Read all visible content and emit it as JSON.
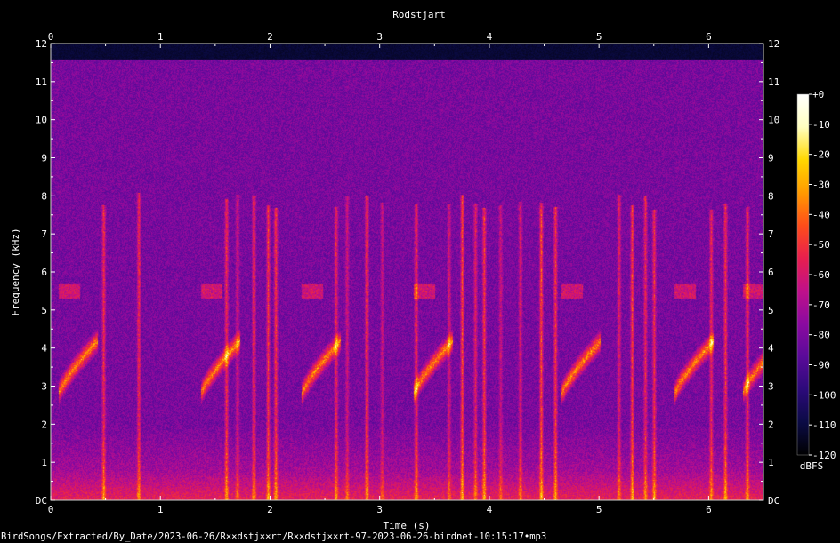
{
  "chart_data": {
    "type": "heatmap",
    "title": "Rodstjart",
    "xlabel": "Time (s)",
    "ylabel": "Frequency (kHz)",
    "xlim": [
      0,
      6.5
    ],
    "ylim": [
      0,
      12
    ],
    "x_ticks": [
      "0",
      "1",
      "2",
      "3",
      "4",
      "5",
      "6"
    ],
    "y_ticks": [
      "DC",
      "1",
      "2",
      "3",
      "4",
      "5",
      "6",
      "7",
      "8",
      "9",
      "10",
      "11",
      "12"
    ],
    "colorbar": {
      "label": "dBFS",
      "range": [
        -120,
        0
      ],
      "ticks": [
        "+0",
        "-10",
        "-20",
        "-30",
        "-40",
        "-50",
        "-60",
        "-70",
        "-80",
        "-90",
        "-100",
        "-110",
        "-120"
      ],
      "colors": [
        "#000000",
        "#0b0b45",
        "#2c0a7a",
        "#5a0a99",
        "#8b0aa0",
        "#c0108a",
        "#e81f4e",
        "#ff4d1a",
        "#ff9a00",
        "#ffd800",
        "#ffffc0",
        "#ffffff"
      ]
    },
    "grid": false,
    "noise_ceiling_khz": 11.6,
    "calls_s": [
      0.18,
      1.48,
      2.4,
      3.42,
      4.77,
      5.8,
      6.42
    ],
    "call_freq_khz": [
      2.8,
      4.2
    ],
    "call_upper_harmonic_khz": 5.5,
    "clicks_s": [
      0.48,
      0.8,
      1.6,
      1.7,
      1.85,
      1.98,
      2.05,
      2.6,
      2.7,
      2.88,
      3.02,
      3.33,
      3.63,
      3.75,
      3.87,
      3.95,
      4.1,
      4.28,
      4.47,
      4.6,
      5.18,
      5.3,
      5.42,
      5.5,
      6.02,
      6.15,
      6.35
    ]
  },
  "footer": {
    "source_path": "BirdSongs/Extracted/By_Date/2023-06-26/R××dstj××rt/R××dstj××rt-97-2023-06-26-birdnet-10:15:17•mp3"
  }
}
